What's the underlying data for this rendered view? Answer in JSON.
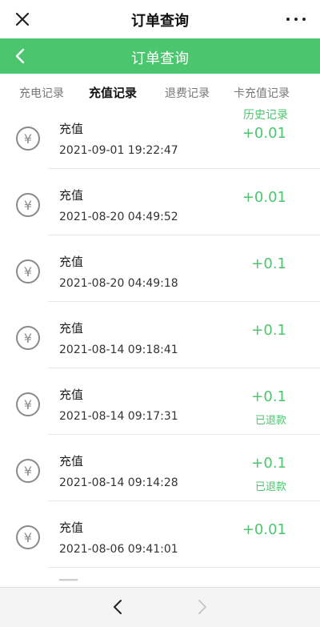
{
  "window": {
    "title": "订单查询"
  },
  "header": {
    "title": "订单查询"
  },
  "tabs": [
    {
      "label": "充电记录",
      "active": false
    },
    {
      "label": "充值记录",
      "active": true
    },
    {
      "label": "退费记录",
      "active": false
    },
    {
      "label": "卡充值记录",
      "active": false
    }
  ],
  "history_link": "历史记录",
  "records": [
    {
      "title": "充值",
      "time": "2021-09-01 19:22:47",
      "amount": "+0.01",
      "status": ""
    },
    {
      "title": "充值",
      "time": "2021-08-20 04:49:52",
      "amount": "+0.01",
      "status": ""
    },
    {
      "title": "充值",
      "time": "2021-08-20 04:49:18",
      "amount": "+0.1",
      "status": ""
    },
    {
      "title": "充值",
      "time": "2021-08-14 09:18:41",
      "amount": "+0.1",
      "status": ""
    },
    {
      "title": "充值",
      "time": "2021-08-14 09:17:31",
      "amount": "+0.1",
      "status": "已退款"
    },
    {
      "title": "充值",
      "time": "2021-08-14 09:14:28",
      "amount": "+0.1",
      "status": "已退款"
    },
    {
      "title": "充值",
      "time": "2021-08-06 09:41:01",
      "amount": "+0.01",
      "status": ""
    }
  ],
  "icons": {
    "close": "close-icon",
    "more": "more-icon",
    "back": "chevron-left-icon",
    "yen": "yen-icon",
    "prev": "chevron-left-icon",
    "next": "chevron-right-icon"
  },
  "colors": {
    "accent": "#4cc66e",
    "disabled": "#c8c8c8"
  }
}
